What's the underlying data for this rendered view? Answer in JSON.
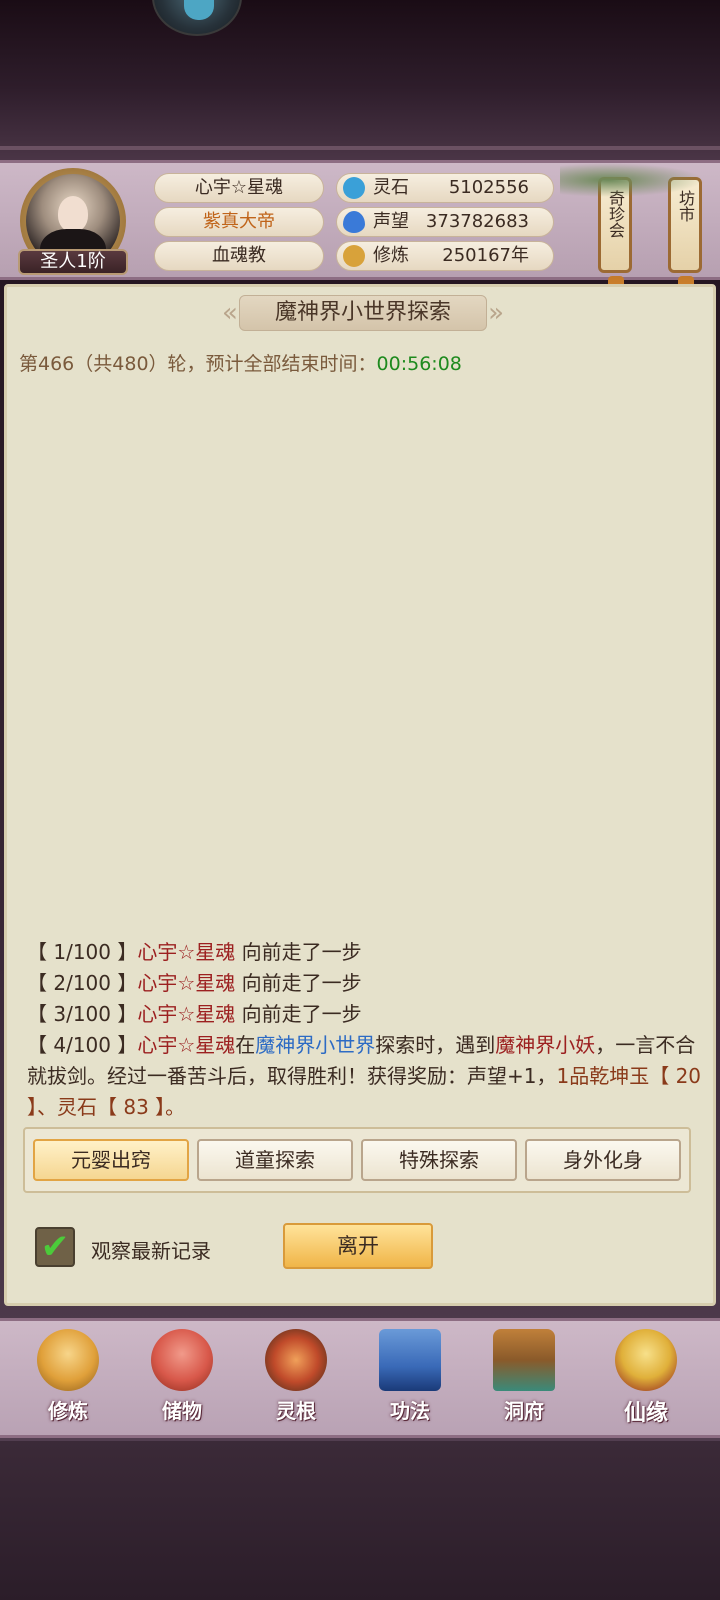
{
  "player": {
    "rank": "圣人1阶",
    "name": "心宇☆星魂",
    "title": "紫真大帝",
    "sect": "血魂教"
  },
  "stats": [
    {
      "label": "灵石",
      "value": "5102556",
      "icon": "spirit-stone-icon",
      "color": "#3aa0d8"
    },
    {
      "label": "声望",
      "value": "373782683",
      "icon": "prestige-flame-icon",
      "color": "#3a7ad8"
    },
    {
      "label": "修炼",
      "value": "250167年",
      "icon": "meditation-icon",
      "color": "#d8a23a"
    }
  ],
  "side_buttons": {
    "treasure_fair": "奇珍会",
    "market": "坊市"
  },
  "panel": {
    "title": "魔神界小世界探索",
    "round_prefix": "第466（共480）轮，预计全部结束时间：",
    "round_time": "00:56:08"
  },
  "log": [
    {
      "step": "【 1/100 】",
      "name": "心宇☆星魂",
      "text": " 向前走了一步"
    },
    {
      "step": "【 2/100 】",
      "name": "心宇☆星魂",
      "text": " 向前走了一步"
    },
    {
      "step": "【 3/100 】",
      "name": "心宇☆星魂",
      "text": " 向前走了一步"
    }
  ],
  "log_event": {
    "step": "【 4/100 】",
    "name": "心宇☆星魂",
    "t1": "在",
    "place": "魔神界小世界",
    "t2": "探索时，遇到",
    "monster": "魔神界小妖",
    "t3": "，一言不合就拔剑。经过一番苦斗后，取得胜利！获得奖励：声望+1，",
    "reward": "1品乾坤玉【 20 】、灵石【 83 】。"
  },
  "tabs": [
    "元婴出窍",
    "道童探索",
    "特殊探索",
    "身外化身"
  ],
  "active_tab": 0,
  "watch_latest_label": "观察最新记录",
  "watch_latest_checked": true,
  "leave_label": "离开",
  "nav": [
    {
      "label": "修炼",
      "icon": "cultivate-monk-icon",
      "color": "#e0a03a"
    },
    {
      "label": "储物",
      "icon": "storage-bag-icon",
      "color": "#d8584a"
    },
    {
      "label": "灵根",
      "icon": "spirit-root-icon",
      "color": "#c04a2a"
    },
    {
      "label": "功法",
      "icon": "technique-book-icon",
      "color": "#3a6ab8"
    },
    {
      "label": "洞府",
      "icon": "cave-house-icon",
      "color": "#c0803a"
    },
    {
      "label": "仙缘",
      "icon": "immortal-gourd-icon",
      "color": "#e0b03a"
    }
  ]
}
